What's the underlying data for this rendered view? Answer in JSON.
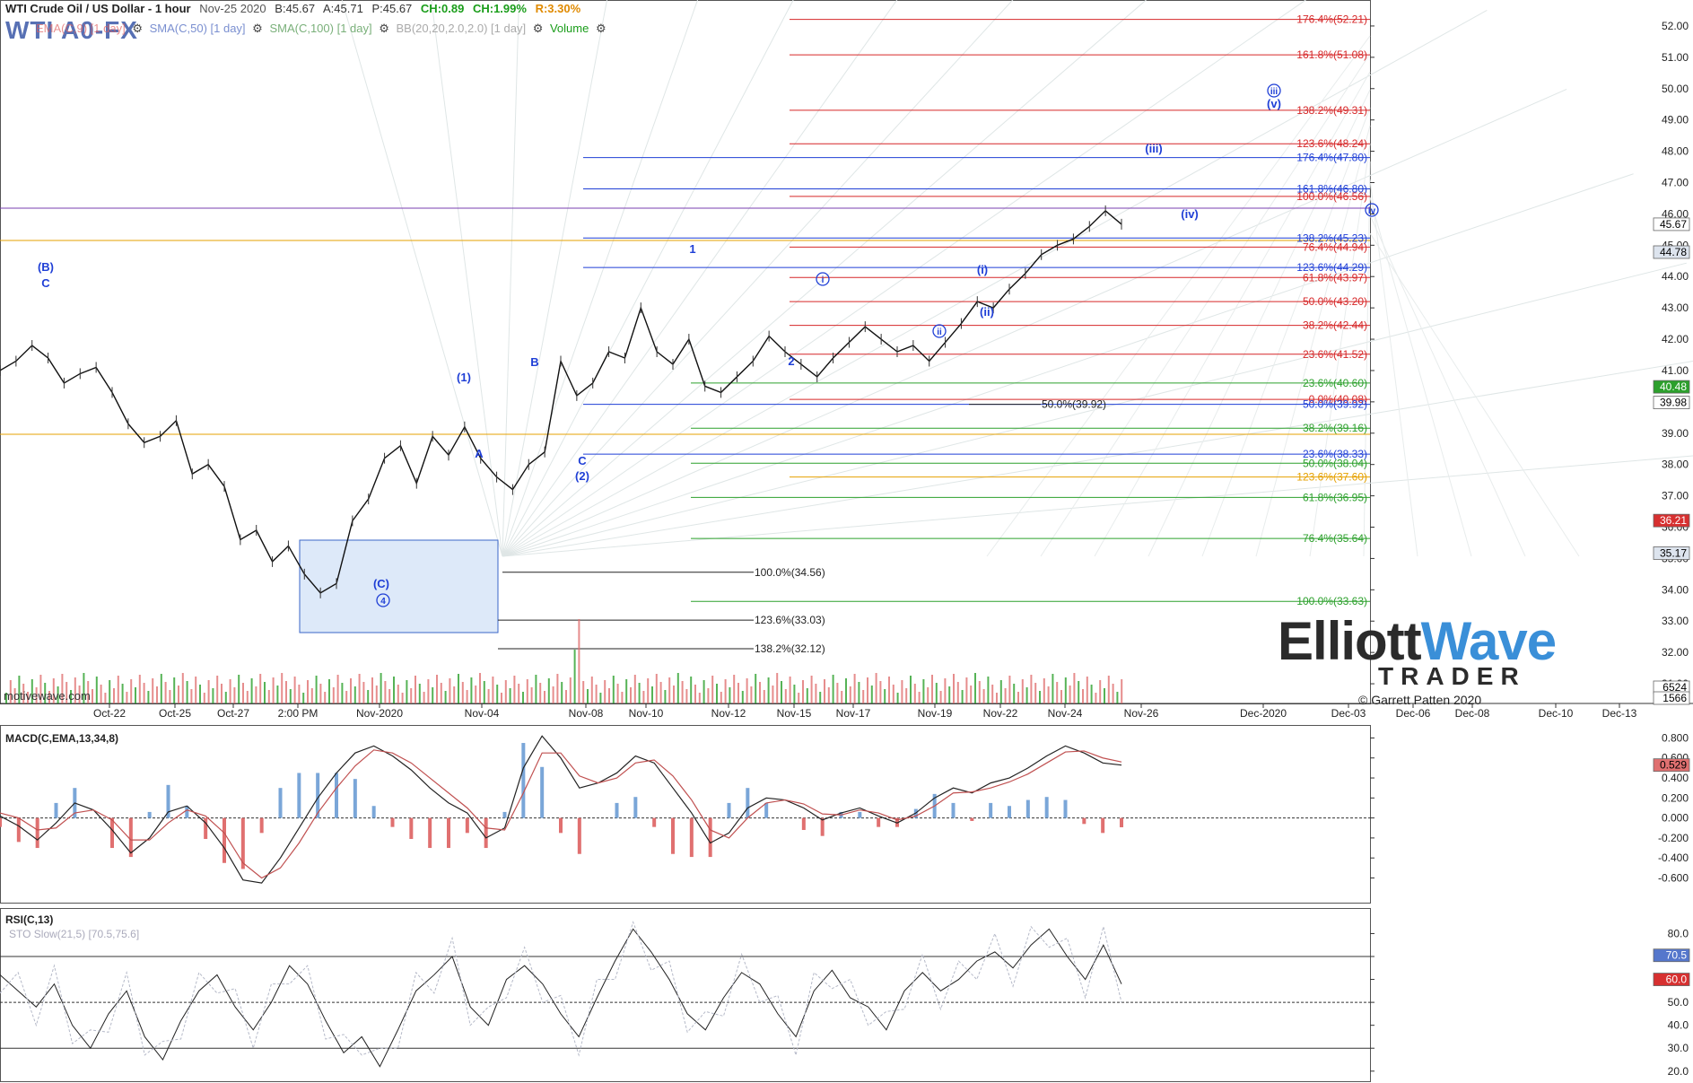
{
  "header": {
    "title": "WTI Crude Oil / US Dollar - 1 hour",
    "date": "Nov-25 2020",
    "bid": "B:45.67",
    "ask": "A:45.71",
    "price": "P:45.67",
    "change": "CH:0.89",
    "change_pct": "CH:1.99%",
    "range": "R:3.30%",
    "symbol": "WTI A0-FX",
    "colors": {
      "up": "#1a9d1a",
      "range": "#e08a00",
      "symbol": "#3a58a8"
    }
  },
  "indicators": [
    {
      "label": "EMA(C,9) [1 day]",
      "color": "#e06060"
    },
    {
      "label": "SMA(C,50) [1 day]",
      "color": "#7a8fd0"
    },
    {
      "label": "SMA(C,100) [1 day]",
      "color": "#7ab07a"
    },
    {
      "label": "BB(20,20,2.0,2.0) [1 day]",
      "color": "#aaaaaa"
    },
    {
      "label": "Volume",
      "color": "#1a9d1a"
    }
  ],
  "watermark": "motivewave.com",
  "logo": {
    "main1": "Elliott",
    "main2": "Wave",
    "sub": "TRADER",
    "copyright": "© Garrett Patten 2020"
  },
  "chart_data": [
    {
      "type": "line",
      "title": "WTI Crude Oil / US Dollar - 1 hour",
      "x_ticks": [
        "Oct-22",
        "Oct-25",
        "Oct-27",
        "2:00 PM",
        "Nov-2020",
        "Nov-04",
        "Nov-08",
        "Nov-10",
        "Nov-12",
        "Nov-15",
        "Nov-17",
        "Nov-19",
        "Nov-22",
        "Nov-24",
        "Nov-26",
        "Dec-2020",
        "Dec-03",
        "Dec-06",
        "Dec-08",
        "Dec-10",
        "Dec-13"
      ],
      "y_ticks": [
        "52.00",
        "51.00",
        "50.00",
        "49.00",
        "48.00",
        "47.00",
        "46.00",
        "45.00",
        "44.00",
        "43.00",
        "42.00",
        "41.00",
        "40.00",
        "39.00",
        "38.00",
        "37.00",
        "36.00",
        "35.00",
        "34.00",
        "33.00",
        "32.00",
        "31.00"
      ],
      "ylim": [
        30.4,
        52.6
      ],
      "series": [
        {
          "values": [
            41.0,
            41.3,
            41.8,
            41.4,
            40.6,
            40.9,
            41.1,
            40.3,
            39.3,
            38.7,
            38.9,
            39.4,
            37.7,
            38.0,
            37.3,
            35.6,
            35.9,
            34.9,
            35.4,
            34.5,
            33.9,
            34.2,
            36.2,
            36.9,
            38.2,
            38.6,
            37.4,
            38.9,
            38.3,
            39.2,
            38.2,
            37.6,
            37.2,
            38.0,
            38.4,
            41.3,
            40.2,
            40.6,
            41.6,
            41.4,
            43.0,
            41.6,
            41.2,
            42.0,
            40.5,
            40.3,
            40.8,
            41.3,
            42.1,
            41.6,
            41.2,
            40.8,
            41.4,
            41.9,
            42.4,
            42.0,
            41.6,
            41.8,
            41.3,
            41.9,
            42.5,
            43.2,
            43.0,
            43.6,
            44.1,
            44.7,
            45.0,
            45.2,
            45.6,
            46.1,
            45.67
          ]
        }
      ],
      "right_markers": [
        {
          "label": "45.67",
          "bg": "#ffffff",
          "fg": "#000000"
        },
        {
          "label": "44.78",
          "bg": "#dde4ee",
          "fg": "#000000"
        },
        {
          "label": "40.48",
          "bg": "#2ca02c",
          "fg": "#ffffff"
        },
        {
          "label": "39.98",
          "bg": "#ffffff",
          "fg": "#000000"
        },
        {
          "label": "36.21",
          "bg": "#d73030",
          "fg": "#ffffff"
        },
        {
          "label": "35.17",
          "bg": "#dde4ee",
          "fg": "#000000"
        },
        {
          "label": "6524",
          "bg": "#ffffff",
          "fg": "#000000"
        },
        {
          "label": "1566",
          "bg": "#ffffff",
          "fg": "#000000"
        }
      ],
      "fib_levels": [
        {
          "label": "176.4%(52.21)",
          "value": 52.21,
          "color": "#d62728"
        },
        {
          "label": "161.8%(51.08)",
          "value": 51.08,
          "color": "#d62728"
        },
        {
          "label": "138.2%(49.31)",
          "value": 49.31,
          "color": "#d62728"
        },
        {
          "label": "123.6%(48.24)",
          "value": 48.24,
          "color": "#d62728"
        },
        {
          "label": "176.4%(47.80)",
          "value": 47.8,
          "color": "#1f3fd6"
        },
        {
          "label": "161.8%(46.80)",
          "value": 46.8,
          "color": "#1f3fd6"
        },
        {
          "label": "100.0%(46.56)",
          "value": 46.56,
          "color": "#d62728"
        },
        {
          "label": "138.2%(45.23)",
          "value": 45.23,
          "color": "#1f3fd6"
        },
        {
          "label": "76.4%(44.94)",
          "value": 44.94,
          "color": "#d62728"
        },
        {
          "label": "123.6%(44.29)",
          "value": 44.29,
          "color": "#1f3fd6"
        },
        {
          "label": "61.8%(43.97)",
          "value": 43.97,
          "color": "#d62728"
        },
        {
          "label": "50.0%(43.20)",
          "value": 43.2,
          "color": "#d62728"
        },
        {
          "label": "38.2%(42.44)",
          "value": 42.44,
          "color": "#d62728"
        },
        {
          "label": "23.6%(41.52)",
          "value": 41.52,
          "color": "#d62728"
        },
        {
          "label": "23.6%(40.60)",
          "value": 40.6,
          "color": "#2ca02c"
        },
        {
          "label": "0.0%(40.08)",
          "value": 40.08,
          "color": "#d62728"
        },
        {
          "label": "50.0%(39.92)",
          "value": 39.92,
          "color": "#1f3fd6"
        },
        {
          "label": "38.2%(39.16)",
          "value": 39.16,
          "color": "#2ca02c"
        },
        {
          "label": "23.6%(38.33)",
          "value": 38.33,
          "color": "#1f3fd6"
        },
        {
          "label": "50.0%(38.04)",
          "value": 38.04,
          "color": "#2ca02c"
        },
        {
          "label": "123.6%(37.60)",
          "value": 37.6,
          "color": "#e6a100"
        },
        {
          "label": "61.8%(36.95)",
          "value": 36.95,
          "color": "#2ca02c"
        },
        {
          "label": "76.4%(35.64)",
          "value": 35.64,
          "color": "#2ca02c"
        },
        {
          "label": "100.0%(33.63)",
          "value": 33.63,
          "color": "#2ca02c"
        }
      ],
      "inner_levels": [
        {
          "label": "50.0%(39.92)",
          "value": 39.92
        },
        {
          "label": "100.0%(34.56)",
          "value": 34.56
        },
        {
          "label": "123.6%(33.03)",
          "value": 33.03
        },
        {
          "label": "138.2%(32.12)",
          "value": 32.12
        }
      ],
      "wave_labels": [
        "(B)",
        "C",
        "(1)",
        "A",
        "B",
        "C",
        "(2)",
        "(C)",
        "4",
        "1",
        "2",
        "i",
        "ii",
        "(i)",
        "(ii)",
        "(iii)",
        "(iv)",
        "iii",
        "(v)",
        "iv"
      ]
    },
    {
      "type": "line",
      "title": "MACD(C,EMA,13,34,8)",
      "y_ticks": [
        "0.800",
        "0.600",
        "0.400",
        "0.200",
        "0.000",
        "-0.200",
        "-0.400",
        "-0.600"
      ],
      "ylim": [
        -0.82,
        0.84
      ],
      "right_markers": [
        {
          "label": "0.529",
          "bg": "#e07070",
          "fg": "#000000"
        }
      ],
      "series": [
        {
          "name": "MACD",
          "values": [
            0.02,
            -0.08,
            -0.22,
            -0.05,
            0.15,
            0.08,
            -0.12,
            -0.35,
            -0.2,
            0.06,
            0.12,
            -0.05,
            -0.3,
            -0.62,
            -0.65,
            -0.4,
            -0.1,
            0.2,
            0.45,
            0.65,
            0.72,
            0.62,
            0.48,
            0.3,
            0.15,
            0.05,
            -0.2,
            -0.1,
            0.5,
            0.82,
            0.6,
            0.3,
            0.35,
            0.45,
            0.62,
            0.55,
            0.3,
            0.05,
            -0.25,
            -0.15,
            0.1,
            0.2,
            0.18,
            0.1,
            -0.02,
            0.05,
            0.1,
            0.02,
            -0.05,
            0.05,
            0.2,
            0.3,
            0.25,
            0.35,
            0.4,
            0.5,
            0.62,
            0.72,
            0.65,
            0.55,
            0.529
          ]
        },
        {
          "name": "Signal",
          "values": [
            0.05,
            0.0,
            -0.12,
            -0.1,
            0.05,
            0.08,
            -0.02,
            -0.22,
            -0.22,
            -0.05,
            0.08,
            0.02,
            -0.15,
            -0.45,
            -0.6,
            -0.5,
            -0.25,
            0.05,
            0.3,
            0.52,
            0.68,
            0.65,
            0.55,
            0.4,
            0.25,
            0.1,
            -0.1,
            -0.12,
            0.25,
            0.65,
            0.65,
            0.42,
            0.35,
            0.4,
            0.55,
            0.58,
            0.42,
            0.18,
            -0.12,
            -0.2,
            0.0,
            0.15,
            0.18,
            0.14,
            0.04,
            0.03,
            0.08,
            0.05,
            -0.02,
            0.02,
            0.12,
            0.25,
            0.26,
            0.3,
            0.36,
            0.44,
            0.55,
            0.66,
            0.67,
            0.6,
            0.56
          ]
        }
      ]
    },
    {
      "type": "line",
      "title": "RSI(C,13)",
      "subtitle": "STO Slow(21,5) [70.5,75.6]",
      "y_ticks": [
        "80.0",
        "70.0",
        "60.0",
        "50.0",
        "40.0",
        "30.0",
        "20.0"
      ],
      "ylim": [
        16,
        88
      ],
      "right_markers": [
        {
          "label": "70.5",
          "bg": "#5577cc",
          "fg": "#ffffff"
        },
        {
          "label": "60.0",
          "bg": "#d73030",
          "fg": "#ffffff"
        }
      ],
      "series": [
        {
          "name": "RSI",
          "values": [
            62,
            55,
            48,
            58,
            40,
            30,
            45,
            55,
            35,
            25,
            42,
            55,
            62,
            48,
            38,
            50,
            66,
            58,
            42,
            28,
            35,
            22,
            38,
            55,
            62,
            70,
            48,
            40,
            60,
            66,
            58,
            45,
            35,
            52,
            68,
            82,
            72,
            60,
            45,
            38,
            52,
            63,
            58,
            45,
            35,
            55,
            64,
            52,
            48,
            38,
            55,
            63,
            55,
            60,
            68,
            72,
            65,
            75,
            82,
            70,
            60,
            75,
            58
          ]
        }
      ],
      "levels": [
        70,
        50,
        30
      ]
    }
  ]
}
